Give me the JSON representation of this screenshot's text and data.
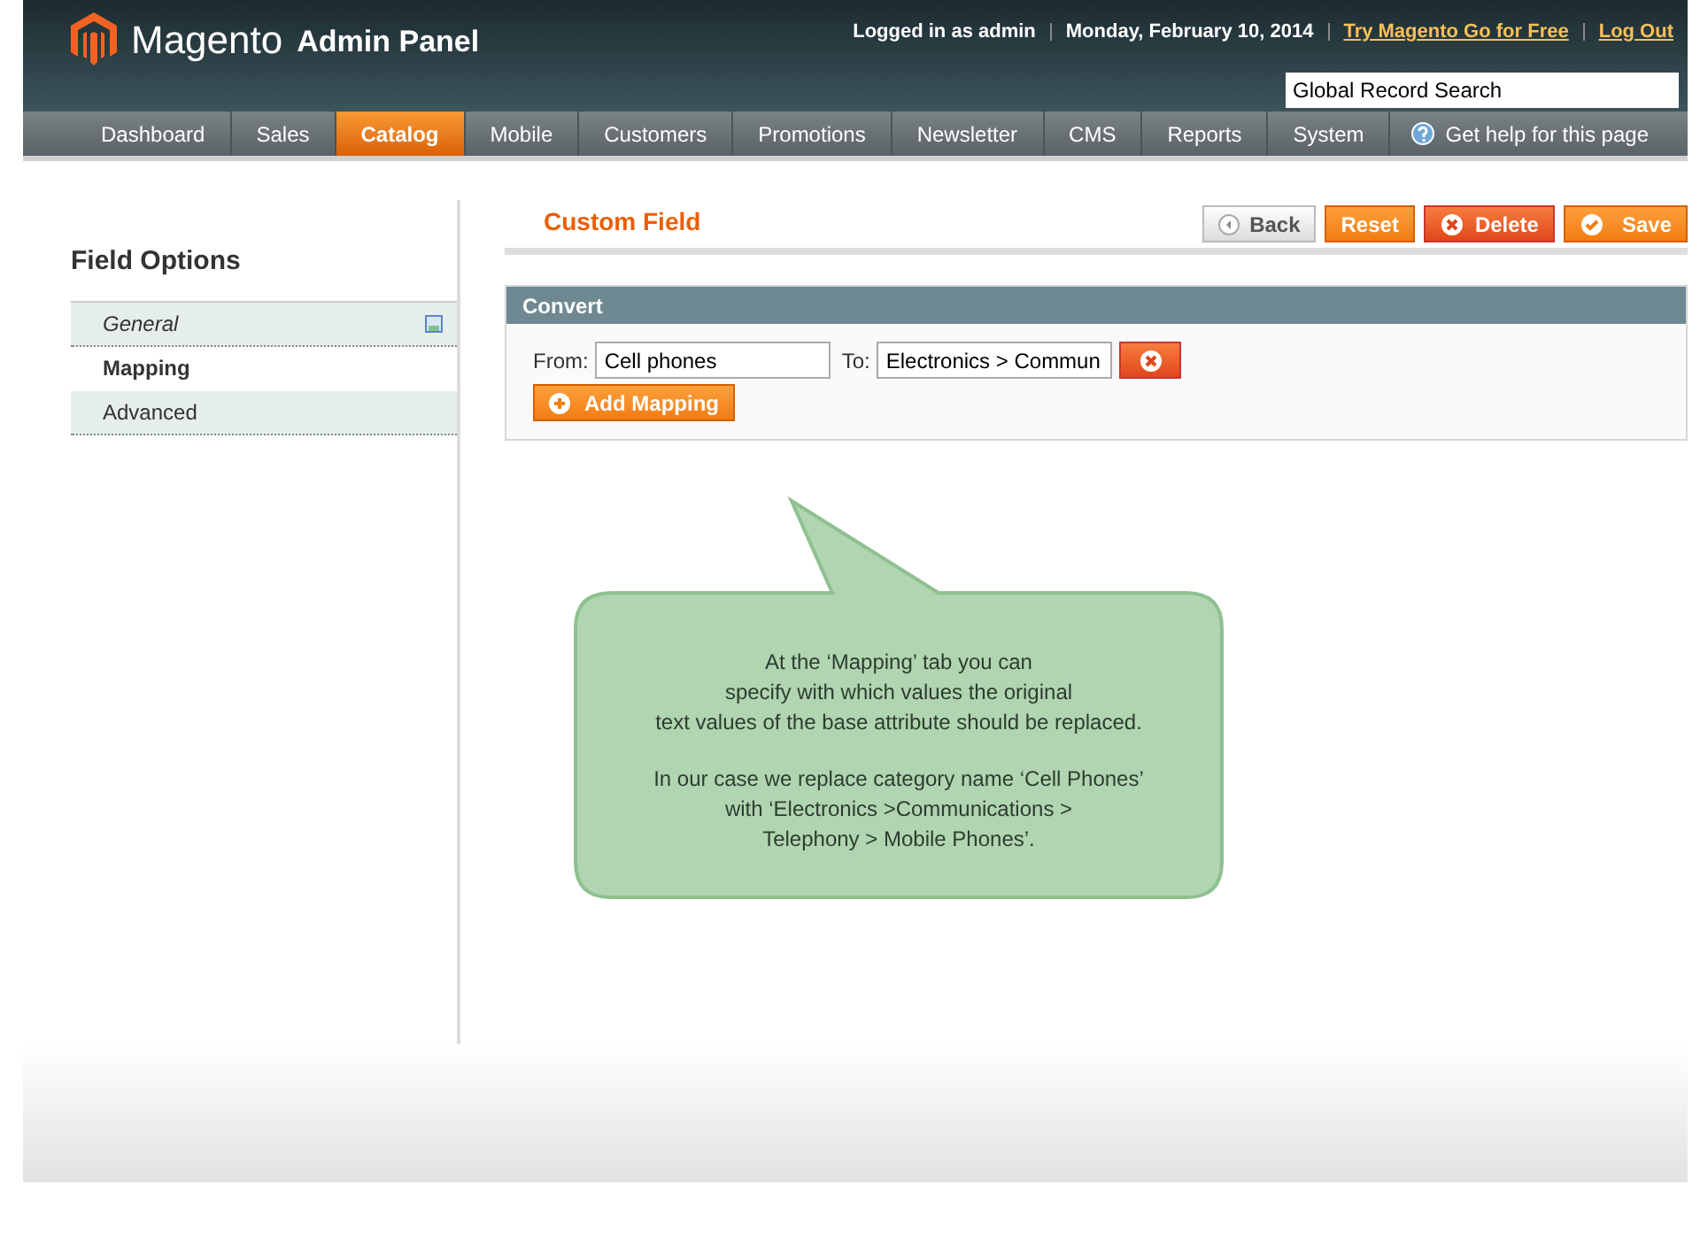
{
  "header": {
    "logo": "Magento",
    "logo_suffix": "Admin Panel",
    "user": "Logged in as admin",
    "date": "Monday, February 10, 2014",
    "links": [
      "Try Magento Go for Free",
      "Log Out"
    ],
    "search": {
      "placeholder": "Global Record Search"
    }
  },
  "nav": {
    "items": [
      {
        "label": "Dashboard",
        "selected": false
      },
      {
        "label": "Sales",
        "selected": false
      },
      {
        "label": "Catalog",
        "selected": true
      },
      {
        "label": "Mobile",
        "selected": false
      },
      {
        "label": "Customers",
        "selected": false
      },
      {
        "label": "Promotions",
        "selected": false
      },
      {
        "label": "Newsletter",
        "selected": false
      },
      {
        "label": "CMS",
        "selected": false
      },
      {
        "label": "Reports",
        "selected": false
      },
      {
        "label": "System",
        "selected": false
      }
    ],
    "help": "Get help for this page"
  },
  "sidebar": {
    "title": "Field Options",
    "items": [
      {
        "label": "General",
        "selected": false,
        "changed": true
      },
      {
        "label": "Mapping",
        "selected": true,
        "changed": false
      },
      {
        "label": "Advanced",
        "selected": false,
        "changed": false
      }
    ]
  },
  "content": {
    "title": "Custom Field",
    "buttons": [
      {
        "label": "Back",
        "kind": "back"
      },
      {
        "label": "Reset",
        "kind": "plain"
      },
      {
        "label": "Delete",
        "kind": "delete"
      },
      {
        "label": "Save",
        "kind": "save"
      }
    ],
    "section": {
      "title": "Convert",
      "from_label": "From:",
      "from_value": "Cell phones",
      "to_label": "To:",
      "to_value": "Electronics > Commun",
      "add_button": "Add Mapping"
    }
  },
  "callout": {
    "paragraphs": [
      [
        "At the ‘Mapping’ tab you can",
        "specify with which values the original",
        "text values of the base attribute should be replaced."
      ],
      [
        "In our case we replace category name ‘Cell Phones’",
        "with ‘Electronics >Communications >",
        "Telephony > Mobile Phones’."
      ]
    ]
  }
}
